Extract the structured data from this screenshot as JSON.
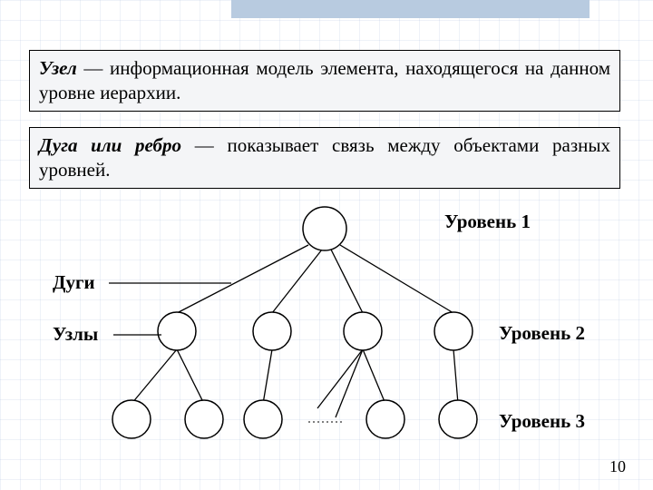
{
  "definitions": {
    "node": {
      "term": "Узел",
      "text": " — информационная модель элемента, находящегося на данном уровне иерархии."
    },
    "edge": {
      "term": "Дуга или ребро",
      "text": " — показывает связь между объектами разных уровней."
    }
  },
  "labels": {
    "level1": "Уровень 1",
    "level2": "Уровень 2",
    "level3": "Уровень 3",
    "arcs": "Дуги",
    "nodes": "Узлы"
  },
  "page_number": "10",
  "chart_data": {
    "type": "tree",
    "levels": [
      {
        "name": "Уровень 1",
        "nodes": 1
      },
      {
        "name": "Уровень 2",
        "nodes": 4
      },
      {
        "name": "Уровень 3",
        "nodes": 5
      }
    ],
    "edges": [
      {
        "from": "L1-1",
        "to": "L2-1"
      },
      {
        "from": "L1-1",
        "to": "L2-2"
      },
      {
        "from": "L1-1",
        "to": "L2-3"
      },
      {
        "from": "L1-1",
        "to": "L2-4"
      },
      {
        "from": "L2-1",
        "to": "L3-1"
      },
      {
        "from": "L2-1",
        "to": "L3-2"
      },
      {
        "from": "L2-2",
        "to": "L3-3"
      },
      {
        "from": "L2-3",
        "to": "L3-4"
      },
      {
        "from": "L2-4",
        "to": "L3-5"
      }
    ],
    "annotations": {
      "arcs_label": "Дуги",
      "nodes_label": "Узлы"
    }
  }
}
